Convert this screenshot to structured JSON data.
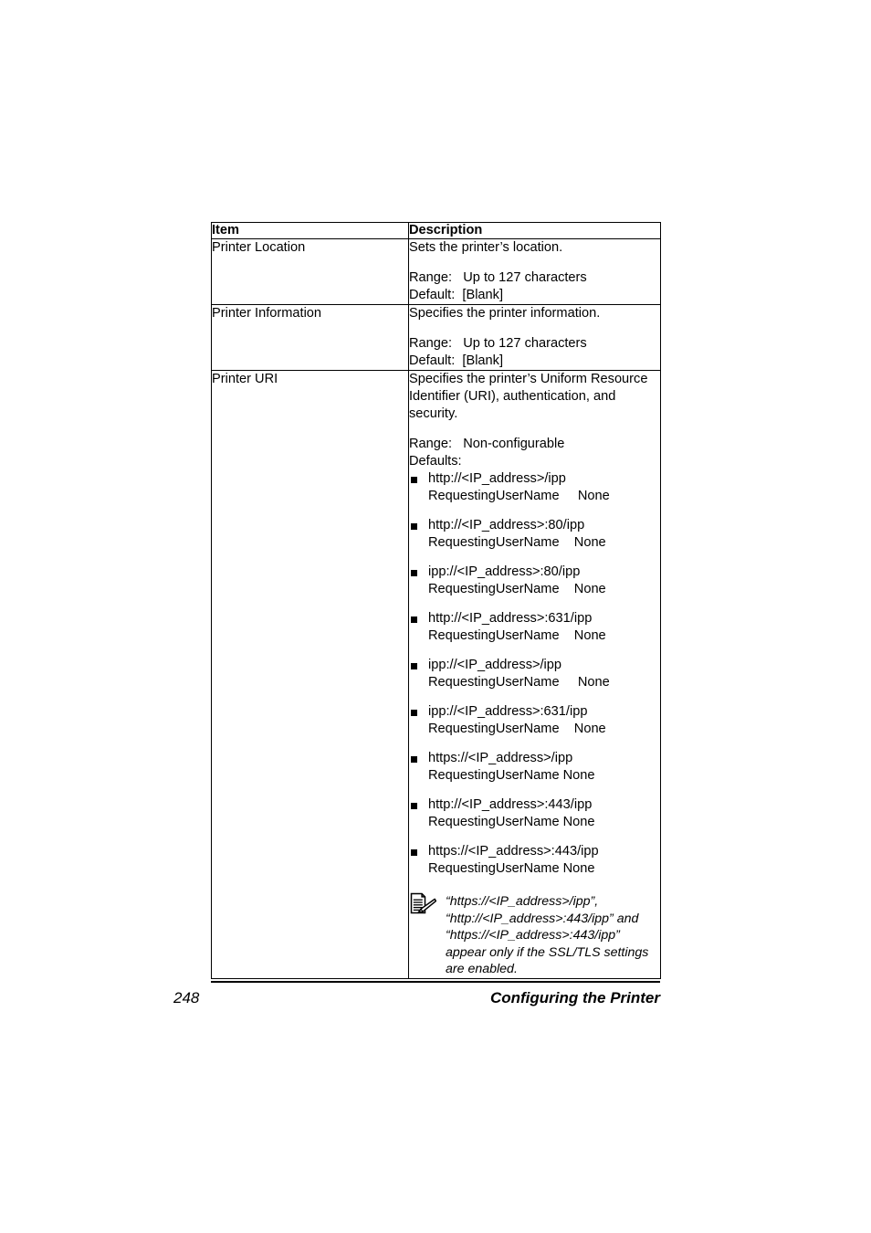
{
  "page": {
    "number": "248",
    "section_title": "Configuring the Printer"
  },
  "table": {
    "headers": {
      "item": "Item",
      "description": "Description"
    },
    "rows": [
      {
        "item": "Printer Location",
        "lead": "Sets the printer’s location.",
        "range_label": "Range:",
        "range_value": "Up to 127 characters",
        "default_label": "Default:",
        "default_value": "[Blank]"
      },
      {
        "item": "Printer Information",
        "lead": "Specifies the printer information.",
        "range_label": "Range:",
        "range_value": "Up to 127 characters",
        "default_label": "Default:",
        "default_value": "[Blank]"
      },
      {
        "item": "Printer URI",
        "lead": "Specifies the printer’s Uniform Resource Identifier (URI), authentication, and security.",
        "range_label": "Range:",
        "range_value": "Non-configurable",
        "defaults_label": "Defaults:",
        "uris": [
          {
            "uri": "http://<IP_address>/ipp",
            "auth": "RequestingUserName     None"
          },
          {
            "uri": "http://<IP_address>:80/ipp",
            "auth": "RequestingUserName    None"
          },
          {
            "uri": "ipp://<IP_address>:80/ipp",
            "auth": "RequestingUserName    None"
          },
          {
            "uri": "http://<IP_address>:631/ipp",
            "auth": "RequestingUserName    None"
          },
          {
            "uri": "ipp://<IP_address>/ipp",
            "auth": "RequestingUserName     None"
          },
          {
            "uri": "ipp://<IP_address>:631/ipp",
            "auth": "RequestingUserName    None"
          },
          {
            "uri": "https://<IP_address>/ipp",
            "auth": "RequestingUserName None"
          },
          {
            "uri": "http://<IP_address>:443/ipp",
            "auth": "RequestingUserName None"
          },
          {
            "uri": "https://<IP_address>:443/ipp",
            "auth": "RequestingUserName None"
          }
        ],
        "note": {
          "icon": "note-document-pencil-icon",
          "text": "“https://<IP_address>/ipp”, “http://<IP_address>:443/ipp” and “https://<IP_address>:443/ipp” appear only if the SSL/TLS settings are enabled."
        }
      }
    ]
  }
}
